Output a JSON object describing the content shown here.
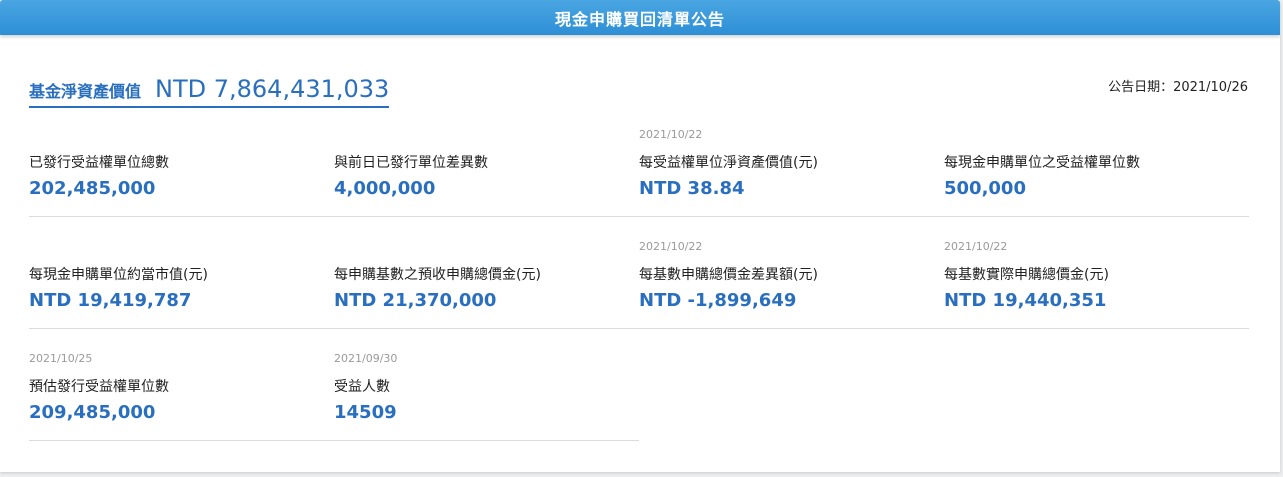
{
  "header": {
    "title": "現金申購買回清單公告"
  },
  "nav": {
    "label": "基金淨資產價值",
    "value": "NTD 7,864,431,033"
  },
  "announce_date": "公告日期：2021/10/26",
  "rows": [
    [
      {
        "date": "",
        "label": "已發行受益權單位總數",
        "value": "202,485,000"
      },
      {
        "date": "",
        "label": "與前日已發行單位差異數",
        "value": "4,000,000"
      },
      {
        "date": "2021/10/22",
        "label": "每受益權單位淨資產價值(元)",
        "value": "NTD 38.84"
      },
      {
        "date": "",
        "label": "每現金申購單位之受益權單位數",
        "value": "500,000"
      }
    ],
    [
      {
        "date": "",
        "label": "每現金申購單位約當市值(元)",
        "value": "NTD 19,419,787"
      },
      {
        "date": "",
        "label": "每申購基數之預收申購總價金(元)",
        "value": "NTD 21,370,000"
      },
      {
        "date": "2021/10/22",
        "label": "每基數申購總價金差異額(元)",
        "value": "NTD -1,899,649"
      },
      {
        "date": "2021/10/22",
        "label": "每基數實際申購總價金(元)",
        "value": "NTD 19,440,351"
      }
    ],
    [
      {
        "date": "2021/10/25",
        "label": "預估發行受益權單位數",
        "value": "209,485,000"
      },
      {
        "date": "2021/09/30",
        "label": "受益人數",
        "value": "14509"
      }
    ]
  ]
}
